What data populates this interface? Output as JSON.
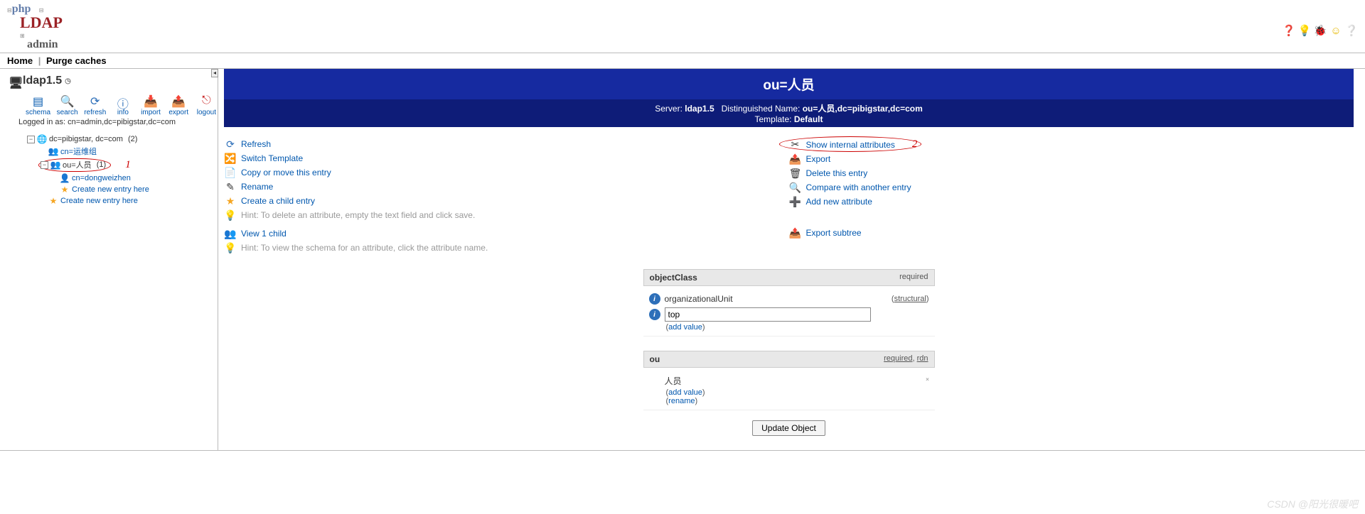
{
  "logo": {
    "p1": "php",
    "p2": "LDAP",
    "p3": "admin"
  },
  "menubar": {
    "home": "Home",
    "purge": "Purge caches"
  },
  "server": {
    "name": "ldap1.5",
    "logged_in_prefix": "Logged in as: ",
    "logged_in_dn": "cn=admin,dc=pibigstar,dc=com"
  },
  "toolbar": {
    "schema": "schema",
    "search": "search",
    "refresh": "refresh",
    "info": "info",
    "import": "import",
    "export": "export",
    "logout": "logout"
  },
  "tree": {
    "root": "dc=pibigstar, dc=com",
    "root_count": "(2)",
    "n1": "cn=运维组",
    "n2": "ou=人员",
    "n2_count": "(1)",
    "anno1": "1",
    "n3": "cn=dongweizhen",
    "new": "Create new entry here"
  },
  "header": {
    "title": "ou=人员",
    "server_label": "Server: ",
    "server": "ldap1.5",
    "dn_label": "Distinguished Name: ",
    "dn": "ou=人员,dc=pibigstar,dc=com",
    "tpl_label": "Template: ",
    "tpl": "Default"
  },
  "actions_left": {
    "refresh": "Refresh",
    "switch": "Switch Template",
    "copy": "Copy or move this entry",
    "rename": "Rename",
    "create": "Create a child entry",
    "hint1": "Hint: To delete an attribute, empty the text field and click save.",
    "view": "View 1 child",
    "hint2": "Hint: To view the schema for an attribute, click the attribute name."
  },
  "actions_right": {
    "show": "Show internal attributes",
    "anno2": "2",
    "export": "Export",
    "delete": "Delete this entry",
    "compare": "Compare with another entry",
    "add": "Add new attribute",
    "export_sub": "Export subtree"
  },
  "attr1": {
    "name": "objectClass",
    "req": "required",
    "val1": "organizationalUnit",
    "flag1": "structural",
    "val2": "top",
    "add": "add value"
  },
  "attr2": {
    "name": "ou",
    "req": "required",
    "rdn": "rdn",
    "val1": "人员",
    "add": "add value",
    "rename": "rename"
  },
  "update_btn": "Update Object",
  "watermark": "CSDN @阳光很暖吧"
}
